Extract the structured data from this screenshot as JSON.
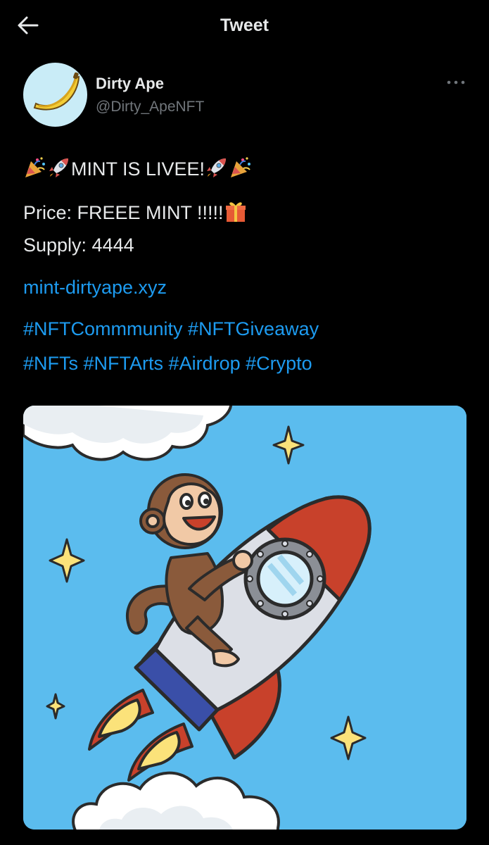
{
  "header": {
    "title": "Tweet"
  },
  "author": {
    "name": "Dirty Ape",
    "handle": "@Dirty_ApeNFT"
  },
  "tweet": {
    "line1_text": "MINT IS LIVEE!",
    "price": "Price: FREEE MINT !!!!!",
    "supply": "Supply: 4444",
    "link": "mint-dirtyape.xyz",
    "hashtags_line1": [
      "#NFTCommmunity",
      "#NFTGiveaway"
    ],
    "hashtags_line2": [
      "#NFTs",
      "#NFTArts",
      "#Airdrop",
      "#Crypto"
    ]
  },
  "icons": [
    "back-arrow-icon",
    "more-options-icon",
    "party-popper-icon",
    "rocket-icon",
    "gift-icon",
    "banana-icon"
  ],
  "colors": {
    "background": "#000000",
    "text": "#e7e9ea",
    "secondary": "#71767b",
    "link": "#1d9bf0",
    "media_sky": "#5bbcee"
  }
}
